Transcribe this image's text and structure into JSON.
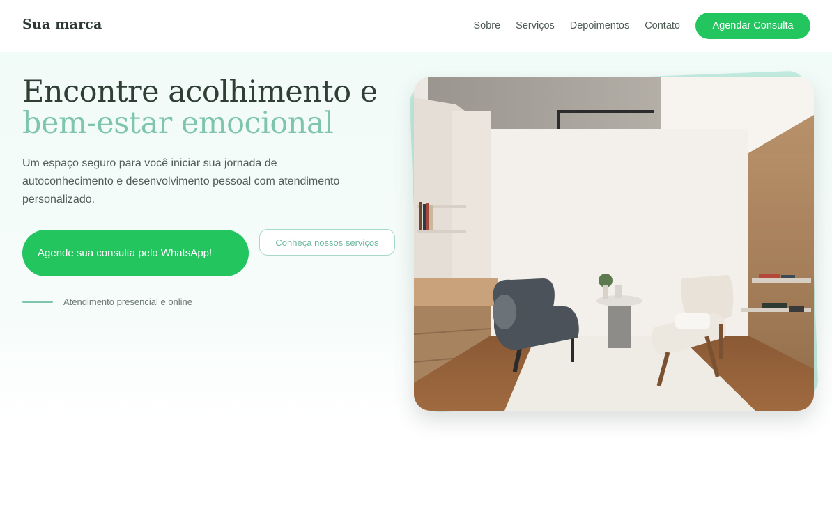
{
  "header": {
    "brand": "Sua marca",
    "nav": [
      "Sobre",
      "Serviços",
      "Depoimentos",
      "Contato"
    ],
    "cta": "Agendar Consulta"
  },
  "hero": {
    "title_line1": "Encontre acolhimento e",
    "title_line2": "bem-estar emocional",
    "description": "Um espaço seguro para você iniciar sua jornada de autoconhecimento e desenvolvimento pessoal com atendimento personalizado.",
    "primary_button": "Agende sua consulta pelo WhatsApp!",
    "secondary_button": "Conheça nossos serviços",
    "note": "Atendimento presencial e online"
  },
  "colors": {
    "brand_green": "#22c55e",
    "accent_mint": "#7fc5ac",
    "photo_backdrop": "#c3ede0"
  }
}
